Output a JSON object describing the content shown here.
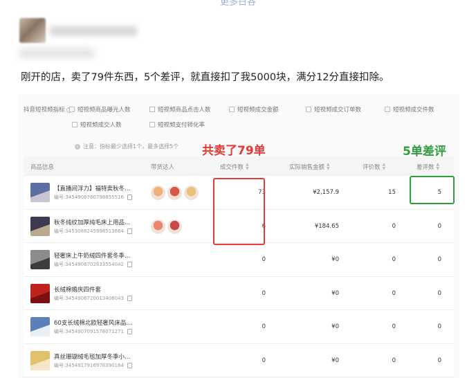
{
  "header": {
    "link_text": "更多日谷"
  },
  "post": {
    "text": "刚开的店，卖了79件东西，5个差评，就直接扣了我5000块，满分12分直接扣除。"
  },
  "metrics": {
    "label": "抖音短视频指标",
    "help": "?",
    "items": [
      "短视频商品曝光人数",
      "短视频商品点击人数",
      "短视频成交金额",
      "短视频成交订单数",
      "短视频成交件数",
      "短视频成交人数",
      "短视频支付转化率"
    ],
    "note": "注意：指标最少选择1个，最多选择5个"
  },
  "table": {
    "columns": [
      "商品信息",
      "带货达人",
      "成交件数",
      "实际销售金额",
      "评价数",
      "差评数"
    ],
    "rows": [
      {
        "name": "【直播间浮力】福特卖秋冬急...",
        "id": "编号:3454906760798855516",
        "sold": "73",
        "amount": "¥2,157.9",
        "reviews": "15",
        "bad": "5",
        "colors": [
          "#5c6fa3",
          "#c9c3d4"
        ],
        "anchors": [
          "#f0b07a",
          "#d9574a",
          "#e7c27b"
        ]
      },
      {
        "name": "秋冬纯纹加厚纯毛床上用品...",
        "id": "编号:3453086245998513664",
        "sold": "6",
        "amount": "¥184.65",
        "reviews": "0",
        "bad": "0",
        "colors": [
          "#3f3a52",
          "#b9a98e"
        ],
        "anchors": [
          "#e8876a",
          "#c74b45"
        ]
      },
      {
        "name": "轻奢床上牛奶绒四件套冬季加...",
        "id": "编号:3454906702833554042",
        "sold": "0",
        "amount": "¥0",
        "reviews": "0",
        "bad": "0",
        "colors": [
          "#8c8a8a",
          "#3c3c40"
        ],
        "anchors": []
      },
      {
        "name": "长绒棉婚庆四件套",
        "id": "编号:3454906720013408043",
        "sold": "0",
        "amount": "¥0",
        "reviews": "0",
        "bad": "0",
        "colors": [
          "#c0221e",
          "#7a1010"
        ],
        "anchors": []
      },
      {
        "name": "60支长绒棉北欧轻奢风床品四...",
        "id": "编号:3454907091578071271",
        "sold": "0",
        "amount": "¥0",
        "reviews": "0",
        "bad": "0",
        "colors": [
          "#5b7fb6",
          "#e8eef6"
        ],
        "anchors": []
      },
      {
        "name": "真丝珊瑚绒毛毯加厚冬季小毯...",
        "id": "编号:3454917916976390164",
        "sold": "0",
        "amount": "¥0",
        "reviews": "0",
        "bad": "0",
        "colors": [
          "#e0c26a",
          "#f4e6c8"
        ],
        "anchors": []
      }
    ]
  },
  "annotations": {
    "total_sold": "共卖了79单",
    "bad_reviews": "5单差评",
    "red": "#e53935",
    "green": "#2e9e3e"
  }
}
